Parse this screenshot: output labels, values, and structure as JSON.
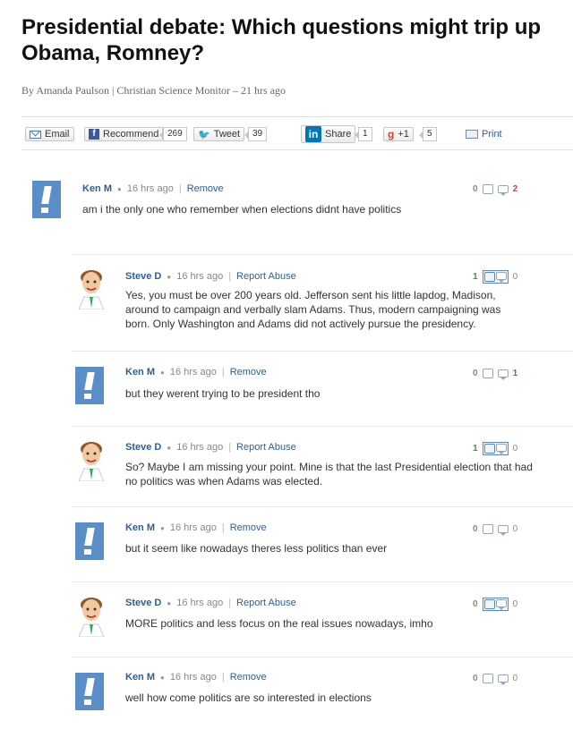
{
  "article": {
    "title": "Presidential debate: Which questions might trip up Obama, Romney?",
    "byline": "By Amanda Paulson | Christian Science Monitor – 21 hrs ago"
  },
  "share": {
    "email_label": "Email",
    "recommend_label": "Recommend",
    "recommend_count": "269",
    "tweet_label": "Tweet",
    "tweet_count": "39",
    "linkedin_label": "Share",
    "linkedin_count": "1",
    "gplus_label": "+1",
    "gplus_count": "5",
    "print_label": "Print"
  },
  "comments": [
    {
      "author": "Ken M",
      "time": "16 hrs ago",
      "action": "Remove",
      "text": "am i the only one who remember when elections didnt have politics",
      "up": "0",
      "replies": "2"
    },
    {
      "author": "Steve D",
      "time": "16 hrs ago",
      "action": "Report Abuse",
      "text": "Yes, you must be over 200 years old. Jefferson sent his little lapdog, Madison, around to campaign and verbally slam Adams. Thus, modern campaigning was born. Only Washington and Adams did not actively pursue the presidency.",
      "up": "1",
      "replies": "0"
    },
    {
      "author": "Ken M",
      "time": "16 hrs ago",
      "action": "Remove",
      "text": "but they werent trying to be president tho",
      "up": "0",
      "replies": "1"
    },
    {
      "author": "Steve D",
      "time": "16 hrs ago",
      "action": "Report Abuse",
      "text": "So? Maybe I am missing your point. Mine is that the last Presidential election that had no politics was when Adams was elected.",
      "up": "1",
      "replies": "0"
    },
    {
      "author": "Ken M",
      "time": "16 hrs ago",
      "action": "Remove",
      "text": "but it seem like nowadays theres less politics than ever",
      "up": "0",
      "replies": "0"
    },
    {
      "author": "Steve D",
      "time": "16 hrs ago",
      "action": "Report Abuse",
      "text": "MORE politics and less focus on the real issues nowadays, imho",
      "up": "0",
      "replies": "0"
    },
    {
      "author": "Ken M",
      "time": "16 hrs ago",
      "action": "Remove",
      "text": "well how come politics are so interested in elections",
      "up": "0",
      "replies": "0"
    }
  ],
  "colors": {
    "link": "#2b5e9a",
    "avatar_blue": "#5b8ec6",
    "up_green": "#3a9a3a",
    "reply_red": "#d73d32"
  }
}
